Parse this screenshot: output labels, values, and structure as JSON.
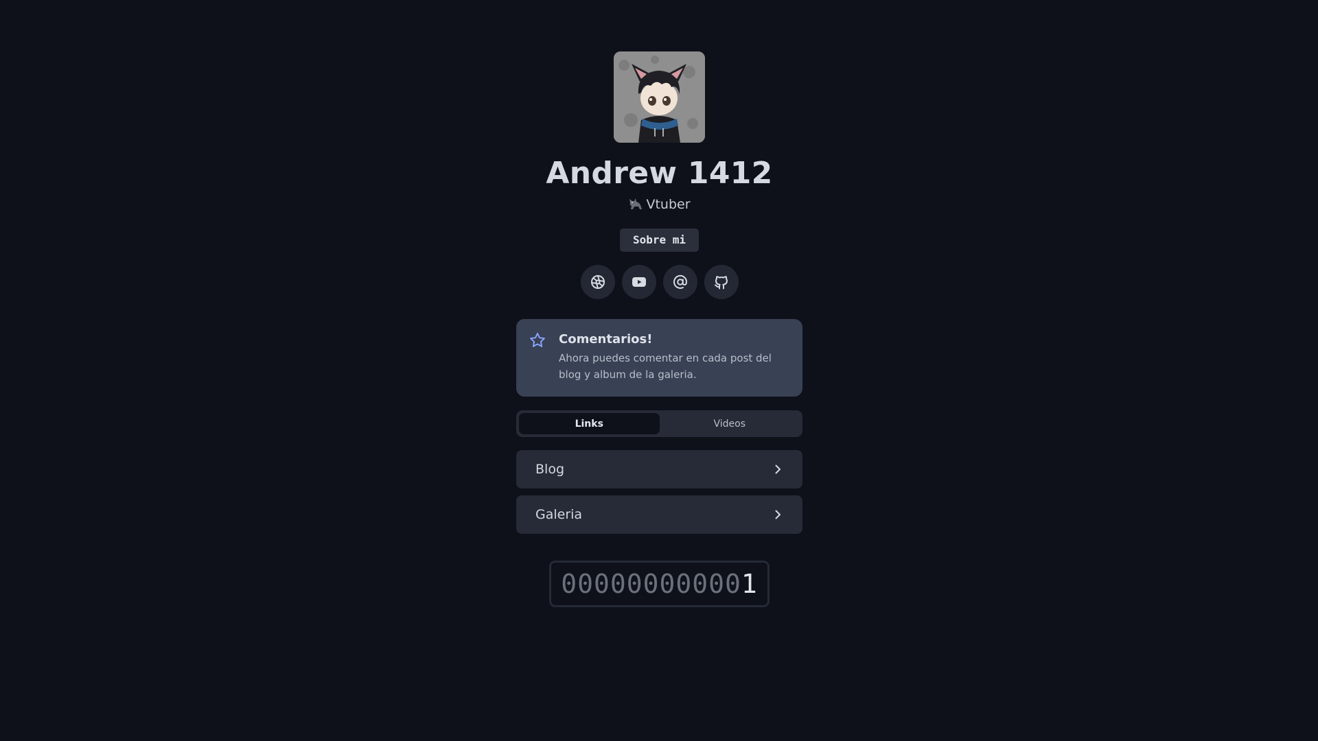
{
  "profile": {
    "name": "Andrew 1412",
    "role_label": "Vtuber",
    "role_icon": "cat-icon",
    "about_button": "Sobre mi"
  },
  "socials": [
    {
      "icon": "globe-network-icon"
    },
    {
      "icon": "youtube-icon"
    },
    {
      "icon": "at-sign-icon"
    },
    {
      "icon": "github-icon"
    }
  ],
  "notice": {
    "icon": "star-icon",
    "title": "Comentarios!",
    "body": "Ahora puedes comentar en cada post del blog y album de la galeria."
  },
  "tabs": {
    "items": [
      {
        "label": "Links",
        "active": true
      },
      {
        "label": "Videos",
        "active": false
      }
    ]
  },
  "links": [
    {
      "label": "Blog"
    },
    {
      "label": "Galeria"
    }
  ],
  "visit_counter": {
    "leading_zeros": "00000000000",
    "value": "1"
  },
  "colors": {
    "background": "#0e111a",
    "card": "#262b37",
    "notice": "#394154",
    "accent_star": "#8aa4ff"
  }
}
